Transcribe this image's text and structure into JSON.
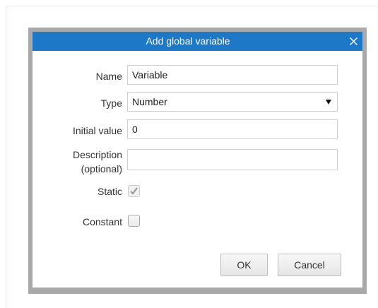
{
  "dialog": {
    "title": "Add global variable"
  },
  "form": {
    "name_label": "Name",
    "name_value": "Variable",
    "type_label": "Type",
    "type_value": "Number",
    "initial_label": "Initial value",
    "initial_value": "0",
    "description_label_line1": "Description",
    "description_label_line2": "(optional)",
    "description_value": "",
    "static_label": "Static",
    "static_checked": true,
    "static_disabled": true,
    "constant_label": "Constant",
    "constant_checked": false
  },
  "buttons": {
    "ok_label": "OK",
    "cancel_label": "Cancel"
  },
  "icons": {
    "close": "close-icon",
    "dropdown": "dropdown-arrow-icon",
    "check": "checkmark-icon"
  },
  "colors": {
    "titlebar": "#1e78c8",
    "frame": "#a9a9a9"
  }
}
